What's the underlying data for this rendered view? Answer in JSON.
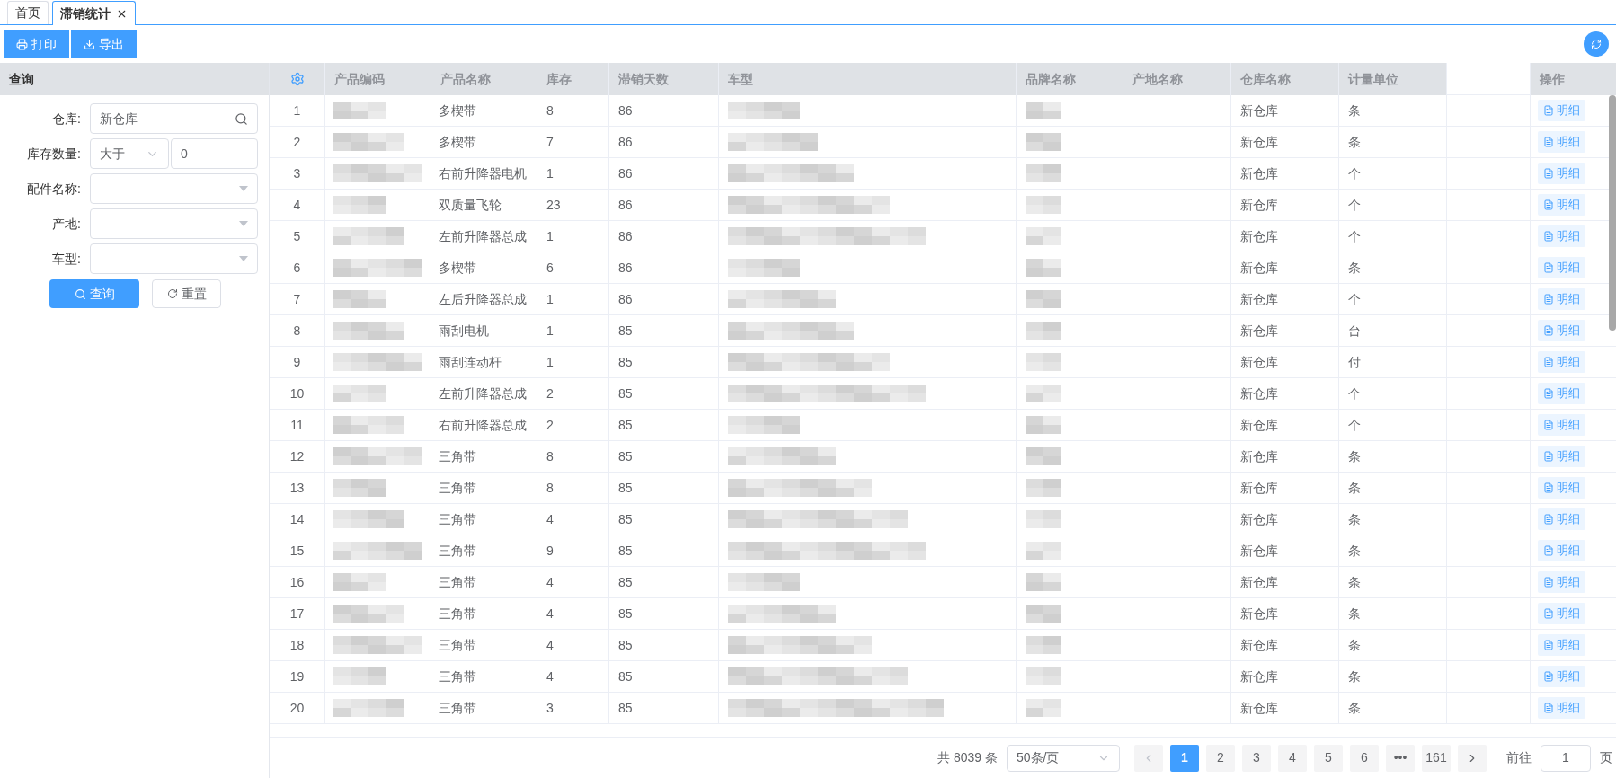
{
  "tabs": [
    {
      "label": "首页",
      "selected": false,
      "closable": false
    },
    {
      "label": "滞销统计",
      "selected": true,
      "closable": true
    }
  ],
  "toolbar": [
    {
      "kind": "print",
      "label": "打印"
    },
    {
      "kind": "export",
      "label": "导出"
    }
  ],
  "query_panel": {
    "title": "查询",
    "fields": [
      {
        "kind": "search",
        "label": "仓库:",
        "value": "新仓库"
      },
      {
        "kind": "compare",
        "label": "库存数量:",
        "operator": "大于",
        "value": "0"
      },
      {
        "kind": "select",
        "label": "配件名称:"
      },
      {
        "kind": "select",
        "label": "产地:"
      },
      {
        "kind": "select",
        "label": "车型:"
      }
    ],
    "buttons": [
      {
        "kind": "primary",
        "label": "查询"
      },
      {
        "kind": "reset",
        "label": "重置"
      }
    ]
  },
  "table": {
    "columns": [
      "产品编码",
      "产品名称",
      "库存",
      "滞销天数",
      "车型",
      "品牌名称",
      "产地名称",
      "仓库名称",
      "计量单位",
      "操作"
    ],
    "rows": [
      {
        "index": "1",
        "name": "多楔带",
        "stock": "8",
        "days": "86",
        "warehouse": "新仓库",
        "unit": "条",
        "action": "明细"
      },
      {
        "index": "2",
        "name": "多楔带",
        "stock": "7",
        "days": "86",
        "warehouse": "新仓库",
        "unit": "条",
        "action": "明细"
      },
      {
        "index": "3",
        "name": "右前升降器电机",
        "stock": "1",
        "days": "86",
        "warehouse": "新仓库",
        "unit": "个",
        "action": "明细"
      },
      {
        "index": "4",
        "name": "双质量飞轮",
        "stock": "23",
        "days": "86",
        "warehouse": "新仓库",
        "unit": "个",
        "action": "明细"
      },
      {
        "index": "5",
        "name": "左前升降器总成",
        "stock": "1",
        "days": "86",
        "warehouse": "新仓库",
        "unit": "个",
        "action": "明细"
      },
      {
        "index": "6",
        "name": "多楔带",
        "stock": "6",
        "days": "86",
        "warehouse": "新仓库",
        "unit": "条",
        "action": "明细"
      },
      {
        "index": "7",
        "name": "左后升降器总成",
        "stock": "1",
        "days": "86",
        "warehouse": "新仓库",
        "unit": "个",
        "action": "明细"
      },
      {
        "index": "8",
        "name": "雨刮电机",
        "stock": "1",
        "days": "85",
        "warehouse": "新仓库",
        "unit": "台",
        "action": "明细"
      },
      {
        "index": "9",
        "name": "雨刮连动杆",
        "stock": "1",
        "days": "85",
        "warehouse": "新仓库",
        "unit": "付",
        "action": "明细"
      },
      {
        "index": "10",
        "name": "左前升降器总成",
        "stock": "2",
        "days": "85",
        "warehouse": "新仓库",
        "unit": "个",
        "action": "明细"
      },
      {
        "index": "11",
        "name": "右前升降器总成",
        "stock": "2",
        "days": "85",
        "warehouse": "新仓库",
        "unit": "个",
        "action": "明细"
      },
      {
        "index": "12",
        "name": "三角带",
        "stock": "8",
        "days": "85",
        "warehouse": "新仓库",
        "unit": "条",
        "action": "明细"
      },
      {
        "index": "13",
        "name": "三角带",
        "stock": "8",
        "days": "85",
        "warehouse": "新仓库",
        "unit": "条",
        "action": "明细"
      },
      {
        "index": "14",
        "name": "三角带",
        "stock": "4",
        "days": "85",
        "warehouse": "新仓库",
        "unit": "条",
        "action": "明细"
      },
      {
        "index": "15",
        "name": "三角带",
        "stock": "9",
        "days": "85",
        "warehouse": "新仓库",
        "unit": "条",
        "action": "明细"
      },
      {
        "index": "16",
        "name": "三角带",
        "stock": "4",
        "days": "85",
        "warehouse": "新仓库",
        "unit": "条",
        "action": "明细"
      },
      {
        "index": "17",
        "name": "三角带",
        "stock": "4",
        "days": "85",
        "warehouse": "新仓库",
        "unit": "条",
        "action": "明细"
      },
      {
        "index": "18",
        "name": "三角带",
        "stock": "4",
        "days": "85",
        "warehouse": "新仓库",
        "unit": "条",
        "action": "明细"
      },
      {
        "index": "19",
        "name": "三角带",
        "stock": "4",
        "days": "85",
        "warehouse": "新仓库",
        "unit": "条",
        "action": "明细"
      },
      {
        "index": "20",
        "name": "三角带",
        "stock": "3",
        "days": "85",
        "warehouse": "新仓库",
        "unit": "条",
        "action": "明细"
      }
    ]
  },
  "pagination": {
    "total": "共 8039 条",
    "page_size": "50条/页",
    "pages": [
      {
        "label": "1",
        "selected": true
      },
      {
        "label": "2",
        "selected": false
      },
      {
        "label": "3",
        "selected": false
      },
      {
        "label": "4",
        "selected": false
      },
      {
        "label": "5",
        "selected": false
      },
      {
        "label": "6",
        "selected": false
      },
      {
        "label": "•••",
        "selected": false
      },
      {
        "label": "161",
        "selected": false
      }
    ],
    "goto_label": "前往",
    "goto_value": "1",
    "goto_suffix": "页"
  }
}
